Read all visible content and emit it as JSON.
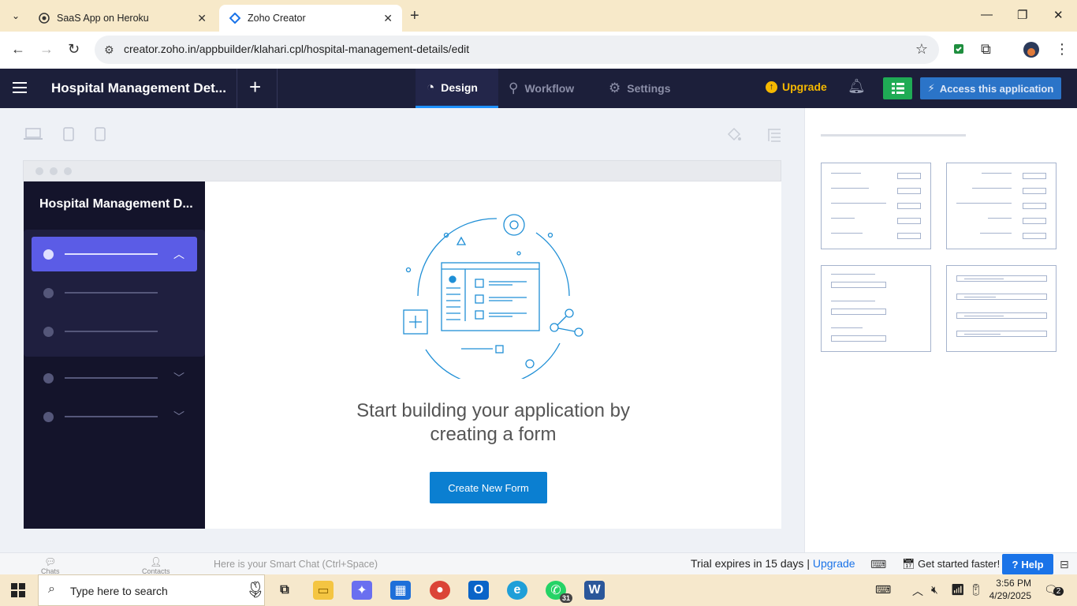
{
  "browser": {
    "tabs": [
      {
        "label": "SaaS App on Heroku",
        "active": false
      },
      {
        "label": "Zoho Creator",
        "active": true
      }
    ],
    "url": "creator.zoho.in/appbuilder/klahari.cpl/hospital-management-details/edit"
  },
  "appbar": {
    "app_title": "Hospital Management Det...",
    "tabs": [
      {
        "label": "Design",
        "icon": "palette-icon",
        "active": true
      },
      {
        "label": "Workflow",
        "icon": "workflow-icon",
        "active": false
      },
      {
        "label": "Settings",
        "icon": "gear-icon",
        "active": false
      }
    ],
    "upgrade_label": "Upgrade",
    "access_label": "Access this application"
  },
  "preview": {
    "sidebar_title": "Hospital Management D...",
    "headline_line1": "Start building your application by",
    "headline_line2": "creating a form",
    "cta_label": "Create New Form"
  },
  "bottombar": {
    "chats_label": "Chats",
    "contacts_label": "Contacts",
    "smartchat_placeholder": "Here is your Smart Chat (Ctrl+Space)",
    "trial_text": "Trial expires in 15 days |",
    "trial_upgrade": "Upgrade",
    "get_started": "Get started faster!",
    "help_label": "Help"
  },
  "taskbar": {
    "search_placeholder": "Type here to search",
    "whatsapp_badge": "31",
    "time": "3:56 PM",
    "date": "4/29/2025",
    "notifications_count": "2"
  },
  "colors": {
    "appbar_bg": "#1c1f3a",
    "accent_blue": "#0b7fd1",
    "upgrade_yellow": "#f5b800",
    "sidebar_selected": "#5b5ce6"
  }
}
